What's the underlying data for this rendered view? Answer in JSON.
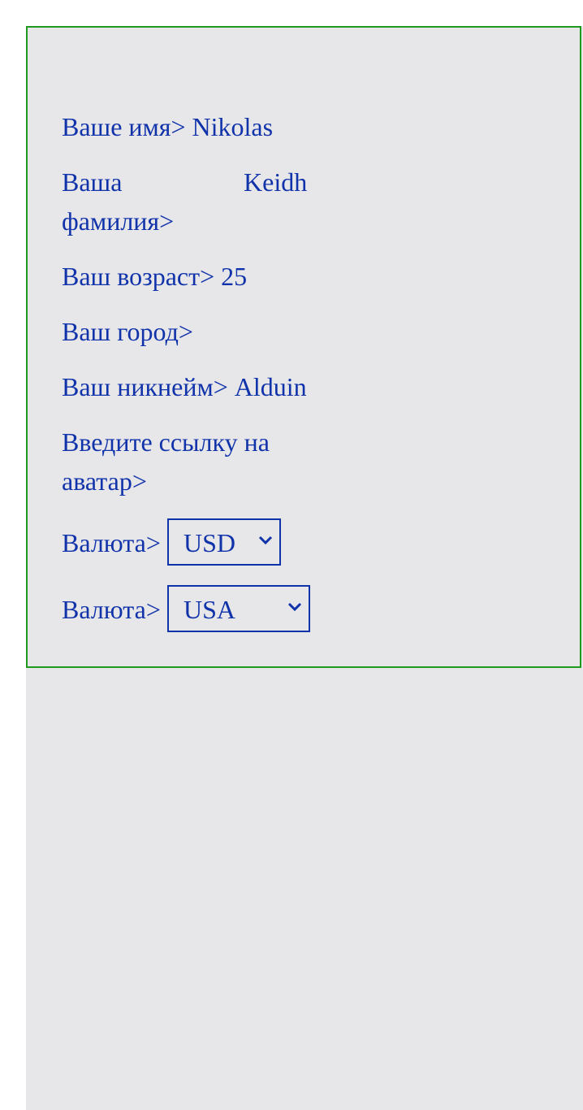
{
  "form": {
    "first_name_label": "Ваше имя>",
    "first_name_value": "Nikolas",
    "last_name_label_line1": "Ваша",
    "last_name_label_line2": "фамилия>",
    "last_name_value": "Keidh",
    "age_label": "Ваш возраст>",
    "age_value": "25",
    "city_label": "Ваш город>",
    "city_value": "",
    "nickname_label": "Ваш никнейм>",
    "nickname_value": "Alduin",
    "avatar_label_line1": "Введите ссылку на",
    "avatar_label_line2": "аватар>",
    "currency_label": "Валюта>",
    "currency_selected": "USD",
    "country_label": "Валюта>",
    "country_selected": "USA"
  },
  "colors": {
    "text": "#1133aa",
    "panel_border": "#1f9a1f",
    "panel_bg": "#e7e7ea"
  }
}
